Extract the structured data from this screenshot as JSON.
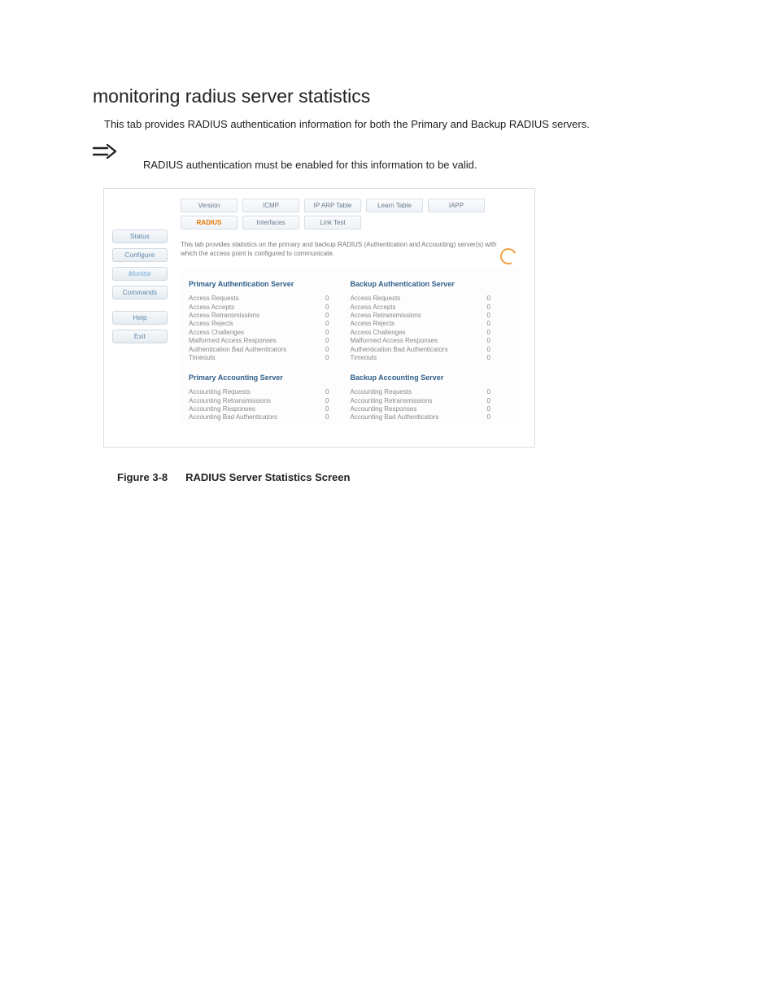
{
  "heading": "monitoring radius server statistics",
  "intro": "This tab provides RADIUS authentication information for both the Primary and Backup RADIUS servers.",
  "note": "RADIUS authentication must be enabled for this information to be valid.",
  "figure_label": "Figure 3-8",
  "figure_title": "RADIUS Server Statistics Screen",
  "side_nav": [
    "Status",
    "Configure",
    "Monitor",
    "Commands",
    "Help",
    "Exit"
  ],
  "side_nav_active": "Monitor",
  "tabs_row1": [
    "Version",
    "ICMP",
    "IP ARP Table",
    "Learn Table"
  ],
  "tabs_row2": [
    "IAPP",
    "RADIUS",
    "Interfaces",
    "Link Test"
  ],
  "tab_active": "RADIUS",
  "tab_desc": "This tab provides statistics on the primary and backup RADIUS (Authentication and Accounting) server(s) with which the access point is configured to communicate.",
  "sections": {
    "primary_auth": {
      "title": "Primary Authentication Server",
      "rows": [
        [
          "Access Requests",
          "0"
        ],
        [
          "Access Accepts",
          "0"
        ],
        [
          "Access Retransmissions",
          "0"
        ],
        [
          "Access Rejects",
          "0"
        ],
        [
          "Access Challenges",
          "0"
        ],
        [
          "Malformed Access Responses",
          "0"
        ],
        [
          "Authentication Bad Authenticators",
          "0"
        ],
        [
          "Timeouts",
          "0"
        ]
      ]
    },
    "backup_auth": {
      "title": "Backup Authentication Server",
      "rows": [
        [
          "Access Requests",
          "0"
        ],
        [
          "Access Accepts",
          "0"
        ],
        [
          "Access Retransmissions",
          "0"
        ],
        [
          "Access Rejects",
          "0"
        ],
        [
          "Access Challenges",
          "0"
        ],
        [
          "Malformed Access Responses",
          "0"
        ],
        [
          "Authentication Bad Authenticators",
          "0"
        ],
        [
          "Timeouts",
          "0"
        ]
      ]
    },
    "primary_acct": {
      "title": "Primary Accounting Server",
      "rows": [
        [
          "Accounting Requests",
          "0"
        ],
        [
          "Accounting Retransmissions",
          "0"
        ],
        [
          "Accounting Responses",
          "0"
        ],
        [
          "Accounting Bad Authenticators",
          "0"
        ]
      ]
    },
    "backup_acct": {
      "title": "Backup Accounting Server",
      "rows": [
        [
          "Accounting Requests",
          "0"
        ],
        [
          "Accounting Retransmissions",
          "0"
        ],
        [
          "Accounting Responses",
          "0"
        ],
        [
          "Accounting Bad Authenticators",
          "0"
        ]
      ]
    }
  }
}
